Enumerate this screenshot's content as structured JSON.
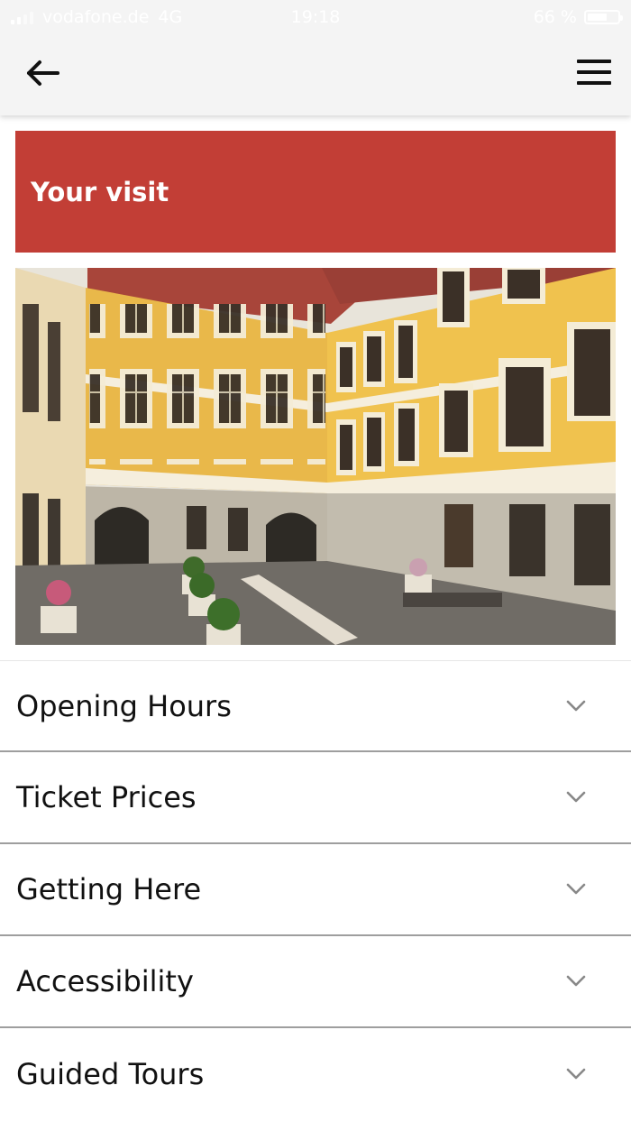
{
  "status_bar": {
    "carrier": "vodafone.de",
    "network": "4G",
    "time": "19:18",
    "battery_percent": "66 %",
    "battery_level": 0.66
  },
  "nav": {
    "back_icon": "arrow-left-icon",
    "menu_icon": "hamburger-menu-icon"
  },
  "banner": {
    "title": "Your visit",
    "color": "#c23e36"
  },
  "hero_image": {
    "subject": "yellow baroque building courtyard"
  },
  "accordion": {
    "items": [
      {
        "label": "Opening Hours"
      },
      {
        "label": "Ticket Prices"
      },
      {
        "label": "Getting Here"
      },
      {
        "label": "Accessibility"
      },
      {
        "label": "Guided Tours"
      }
    ],
    "chevron_icon": "chevron-down-icon"
  }
}
